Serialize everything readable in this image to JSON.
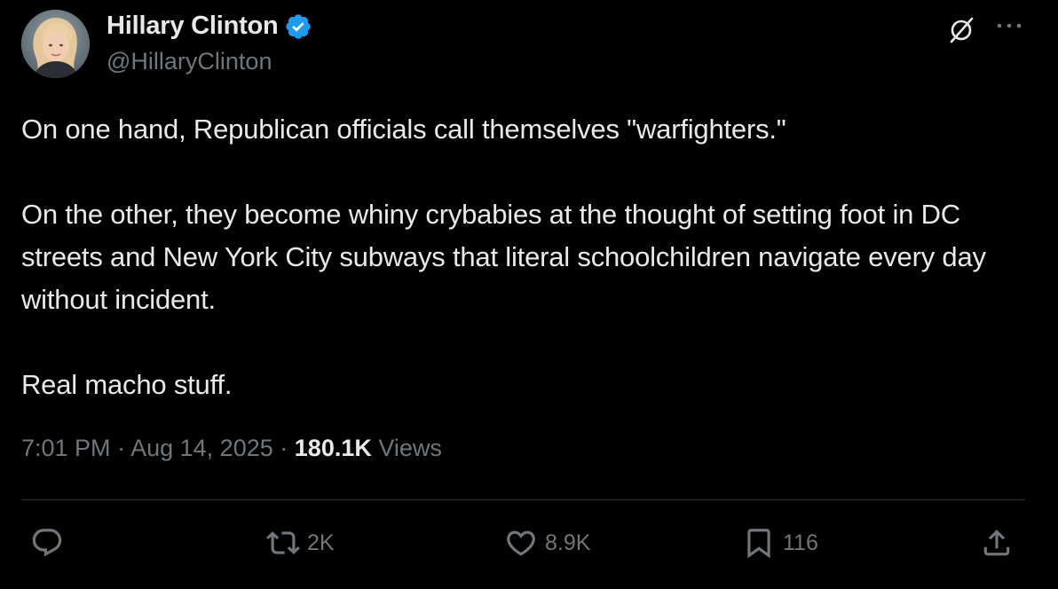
{
  "author": {
    "display_name": "Hillary Clinton",
    "handle": "@HillaryClinton",
    "verified": true,
    "verified_color": "#1d9bf0"
  },
  "tweet": {
    "paragraph_1": "On one hand, Republican officials call themselves \"warfighters.\"",
    "paragraph_2": "On the other, they become whiny crybabies at the thought of setting foot in DC streets and New York City subways that literal schoolchildren navigate every day without incident.",
    "paragraph_3": "Real macho stuff."
  },
  "meta": {
    "time": "7:01 PM",
    "separator": "·",
    "date": "Aug 14, 2025",
    "views_count": "180.1K",
    "views_label": "Views"
  },
  "actions": {
    "reply_count": "",
    "repost_count": "2K",
    "like_count": "8.9K",
    "bookmark_count": "116"
  },
  "icons": {
    "verified": "verified-badge-icon",
    "grok": "grok-icon",
    "more": "more-options-icon",
    "reply": "reply-icon",
    "repost": "repost-icon",
    "like": "heart-icon",
    "bookmark": "bookmark-icon",
    "share": "share-icon"
  },
  "colors": {
    "background": "#000000",
    "text_primary": "#e7e9ea",
    "text_secondary": "#71767b",
    "divider": "#2f3336"
  }
}
